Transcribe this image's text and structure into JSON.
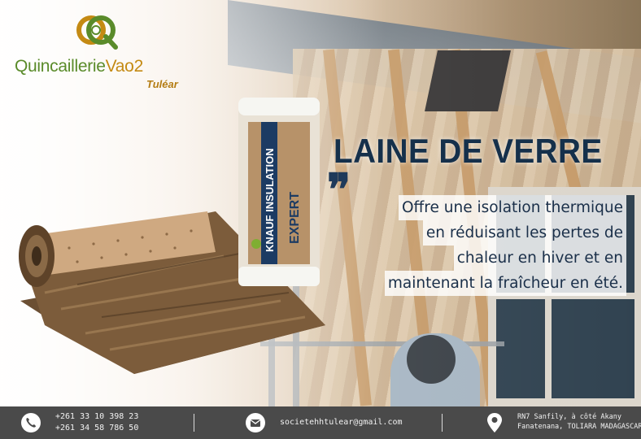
{
  "brand": {
    "name_main": "Quincaillerie",
    "name_suffix": "Vao2",
    "city": "Tuléar",
    "colors": {
      "green": "#5a8b2a",
      "gold": "#c48a13",
      "navy": "#15304b"
    }
  },
  "product": {
    "brand_print": "KNAUF INSULATION",
    "range_print": "EXPERT",
    "label": "Laine de verre roll"
  },
  "headline": {
    "title": "LAINE DE VERRE",
    "quote_mark": "❞",
    "lines": [
      "Offre une isolation thermique",
      "en réduisant les pertes de",
      "chaleur en hiver et en",
      "maintenant la fraîcheur en été."
    ]
  },
  "footer": {
    "phone_1": "+261 33 10 398 23",
    "phone_2": "+261 34 58 786 50",
    "email": "societehhtulear@gmail.com",
    "address_1": "RN7 Sanfily, à côté Akany",
    "address_2": "Fanatenana, TOLIARA MADAGASCAR",
    "icons": [
      "phone-icon",
      "mail-icon",
      "location-pin-icon"
    ]
  }
}
